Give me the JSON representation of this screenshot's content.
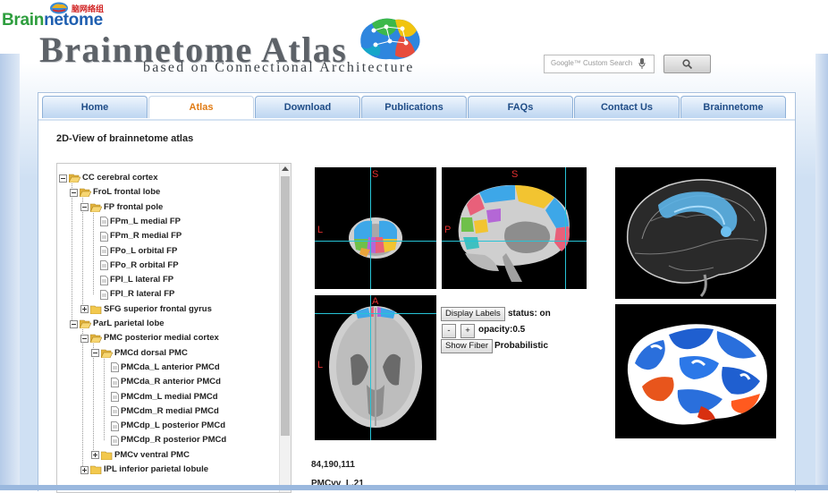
{
  "corner_logo": {
    "part_green": "Brain",
    "part_blue": "netome",
    "chinese": "脑网络组"
  },
  "header": {
    "title": "Brainnetome Atlas",
    "subtitle": "based on Connectional Architecture"
  },
  "search": {
    "placeholder": "Google™ Custom Search"
  },
  "nav": {
    "tabs": [
      {
        "label": "Home"
      },
      {
        "label": "Atlas",
        "active": true
      },
      {
        "label": "Download"
      },
      {
        "label": "Publications"
      },
      {
        "label": "FAQs"
      },
      {
        "label": "Contact Us"
      },
      {
        "label": "Brainnetome"
      }
    ]
  },
  "page": {
    "heading": "2D-View of brainnetome atlas"
  },
  "tree": {
    "items": [
      {
        "label": "CC cerebral cortex",
        "level": 0,
        "kind": "open"
      },
      {
        "label": "FroL frontal lobe",
        "level": 1,
        "kind": "open"
      },
      {
        "label": "FP frontal pole",
        "level": 2,
        "kind": "open"
      },
      {
        "label": "FPm_L medial FP",
        "level": 3,
        "kind": "leaf"
      },
      {
        "label": "FPm_R medial FP",
        "level": 3,
        "kind": "leaf"
      },
      {
        "label": "FPo_L orbital FP",
        "level": 3,
        "kind": "leaf"
      },
      {
        "label": "FPo_R orbital FP",
        "level": 3,
        "kind": "leaf"
      },
      {
        "label": "FPl_L lateral FP",
        "level": 3,
        "kind": "leaf"
      },
      {
        "label": "FPl_R lateral FP",
        "level": 3,
        "kind": "leaf"
      },
      {
        "label": "SFG superior frontal gyrus",
        "level": 2,
        "kind": "closed"
      },
      {
        "label": "ParL parietal lobe",
        "level": 1,
        "kind": "open"
      },
      {
        "label": "PMC posterior medial cortex",
        "level": 2,
        "kind": "open"
      },
      {
        "label": "PMCd dorsal PMC",
        "level": 3,
        "kind": "open"
      },
      {
        "label": "PMCda_L anterior PMCd",
        "level": 4,
        "kind": "leaf"
      },
      {
        "label": "PMCda_R anterior PMCd",
        "level": 4,
        "kind": "leaf"
      },
      {
        "label": "PMCdm_L medial PMCd",
        "level": 4,
        "kind": "leaf"
      },
      {
        "label": "PMCdm_R medial PMCd",
        "level": 4,
        "kind": "leaf"
      },
      {
        "label": "PMCdp_L posterior PMCd",
        "level": 4,
        "kind": "leaf"
      },
      {
        "label": "PMCdp_R posterior PMCd",
        "level": 4,
        "kind": "leaf"
      },
      {
        "label": "PMCv ventral PMC",
        "level": 3,
        "kind": "closed"
      },
      {
        "label": "IPL inferior parietal lobule",
        "level": 2,
        "kind": "closed"
      }
    ]
  },
  "views": {
    "coronal": {
      "top_label": "S",
      "left_label": "L"
    },
    "sagittal": {
      "top_label": "S",
      "left_label": "P"
    },
    "axial": {
      "top_label": "A",
      "left_label": "L"
    }
  },
  "controls": {
    "display_labels_button": "Display Labels",
    "status_text": "status: on",
    "minus_button": "-",
    "plus_button": "+",
    "opacity_text": "opacity:0.5",
    "show_fiber_button": "Show Fiber",
    "fiber_mode": "Probabilistic"
  },
  "info": {
    "coordinates": "84,190,111",
    "region": "PMCvv_L.21"
  },
  "colors": {
    "tab_active_text": "#e07b14",
    "tab_text": "#1f4c86",
    "crosshair": "#27c3d6",
    "orient_label": "#e53030"
  }
}
